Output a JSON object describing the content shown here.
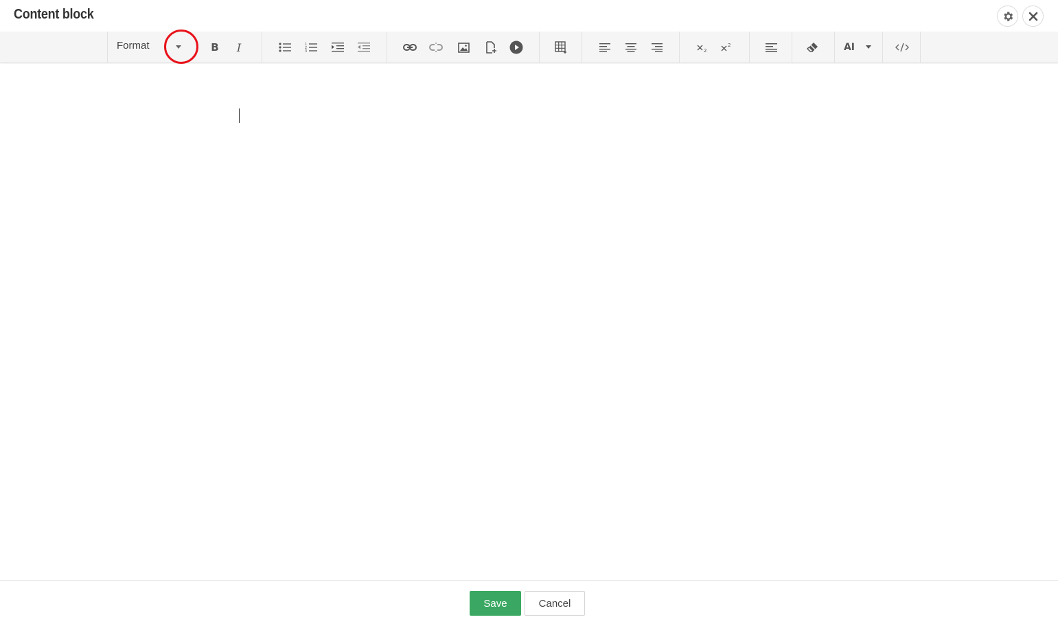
{
  "header": {
    "title": "Content block",
    "settings_icon": "gear-icon",
    "close_icon": "close-icon"
  },
  "toolbar": {
    "format_label": "Format",
    "bold_label": "B",
    "italic_label": "I",
    "ai_label": "AI",
    "buttons": [
      "format-dropdown",
      "bold",
      "italic",
      "bulleted-list",
      "numbered-list",
      "indent",
      "outdent",
      "link",
      "unlink",
      "insert-image",
      "insert-file",
      "insert-video",
      "insert-table",
      "align-left",
      "align-center",
      "align-right",
      "subscript",
      "superscript",
      "paragraph-align",
      "clear-formatting",
      "ai-assistant",
      "source-code"
    ]
  },
  "footer": {
    "save_label": "Save",
    "cancel_label": "Cancel"
  },
  "colors": {
    "accent_green": "#3aa862",
    "highlight_red": "#e8131b",
    "toolbar_bg": "#f5f5f5"
  }
}
